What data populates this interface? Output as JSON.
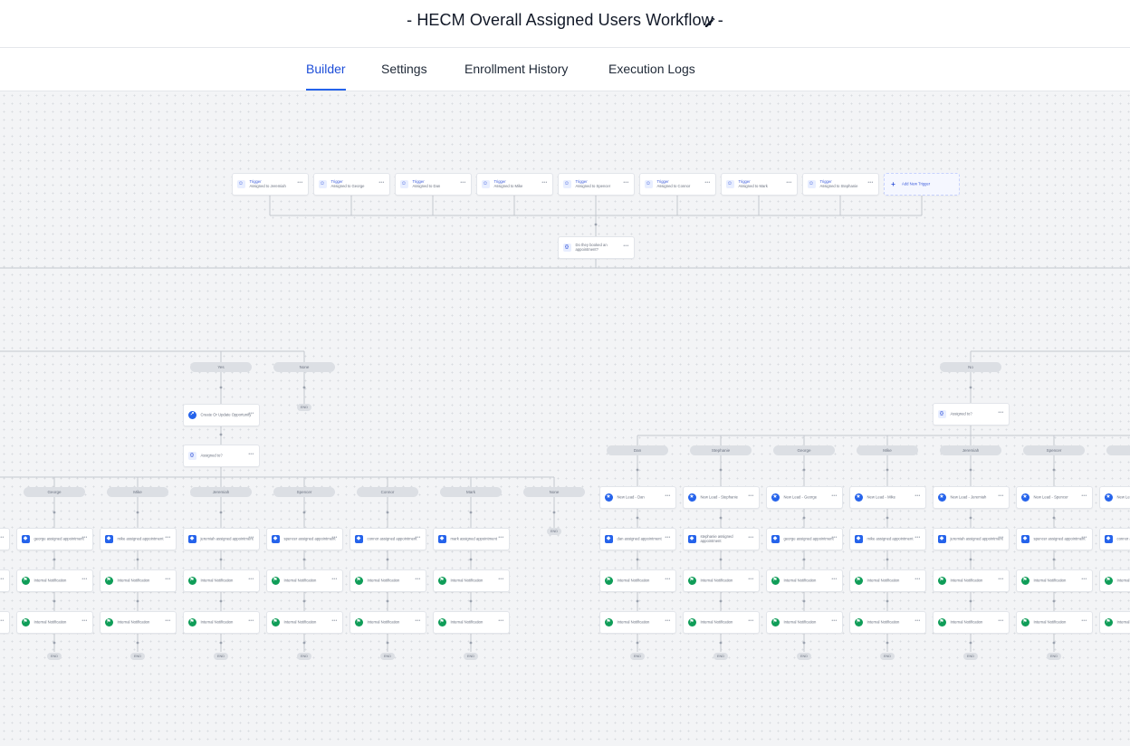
{
  "header": {
    "title": "- HECM Overall Assigned Users Workflow -",
    "edit_icon": "pencil-icon"
  },
  "tabs": [
    {
      "label": "Builder",
      "active": true
    },
    {
      "label": "Settings",
      "active": false
    },
    {
      "label": "Enrollment History",
      "active": false
    },
    {
      "label": "Execution Logs",
      "active": false
    }
  ],
  "triggers": [
    {
      "title": "Trigger",
      "subtitle": "Assigned to Jeremiah"
    },
    {
      "title": "Trigger",
      "subtitle": "Assigned to George"
    },
    {
      "title": "Trigger",
      "subtitle": "Assigned to Dan"
    },
    {
      "title": "Trigger",
      "subtitle": "Assigned to Mike"
    },
    {
      "title": "Trigger",
      "subtitle": "Assigned to Spencer"
    },
    {
      "title": "Trigger",
      "subtitle": "Assigned to Connor"
    },
    {
      "title": "Trigger",
      "subtitle": "Assigned to Mark"
    },
    {
      "title": "Trigger",
      "subtitle": "Assigned to Stephanie"
    }
  ],
  "add_trigger_label": "Add New Trigger",
  "first_condition": "Do they booked an appointment?",
  "left_branch": {
    "branches": [
      "Yes",
      "None"
    ],
    "opportunity": "Create Or Update Opportunity",
    "assigned_condition": "Assigned to?",
    "columns": [
      {
        "name": "George",
        "tag": "george assigned appointment"
      },
      {
        "name": "Mike",
        "tag": "mike assigned appointment"
      },
      {
        "name": "Jeremiah",
        "tag": "jeremiah assigned appointment"
      },
      {
        "name": "Spencer",
        "tag": "spencer assigned appointment"
      },
      {
        "name": "Connor",
        "tag": "connor assigned appointment"
      },
      {
        "name": "Mark",
        "tag": "mark assigned appointment"
      }
    ],
    "none_label": "None"
  },
  "right_branch": {
    "branch": "No",
    "assigned_condition": "Assigned to?",
    "columns": [
      {
        "name": "Dan",
        "lead": "New Lead - Dan",
        "tag": "dan assigned appointment"
      },
      {
        "name": "Stephanie",
        "lead": "New Lead - Stephanie",
        "tag": "stephanie assigned appointment"
      },
      {
        "name": "George",
        "lead": "New Lead - George",
        "tag": "george assigned appointment"
      },
      {
        "name": "Mike",
        "lead": "New Lead - Mike",
        "tag": "mike assigned appointment"
      },
      {
        "name": "Jeremiah",
        "lead": "New Lead - Jeremiah",
        "tag": "jeremiah assigned appointment"
      },
      {
        "name": "Spencer",
        "lead": "New Lead - Spencer",
        "tag": "spencer assigned appointment"
      },
      {
        "name": "",
        "lead": "New Lead",
        "tag": "connor assigned appointment"
      }
    ]
  },
  "internal_notification": "Internal Notification",
  "end_label": "END",
  "menu_glyph": "•••"
}
